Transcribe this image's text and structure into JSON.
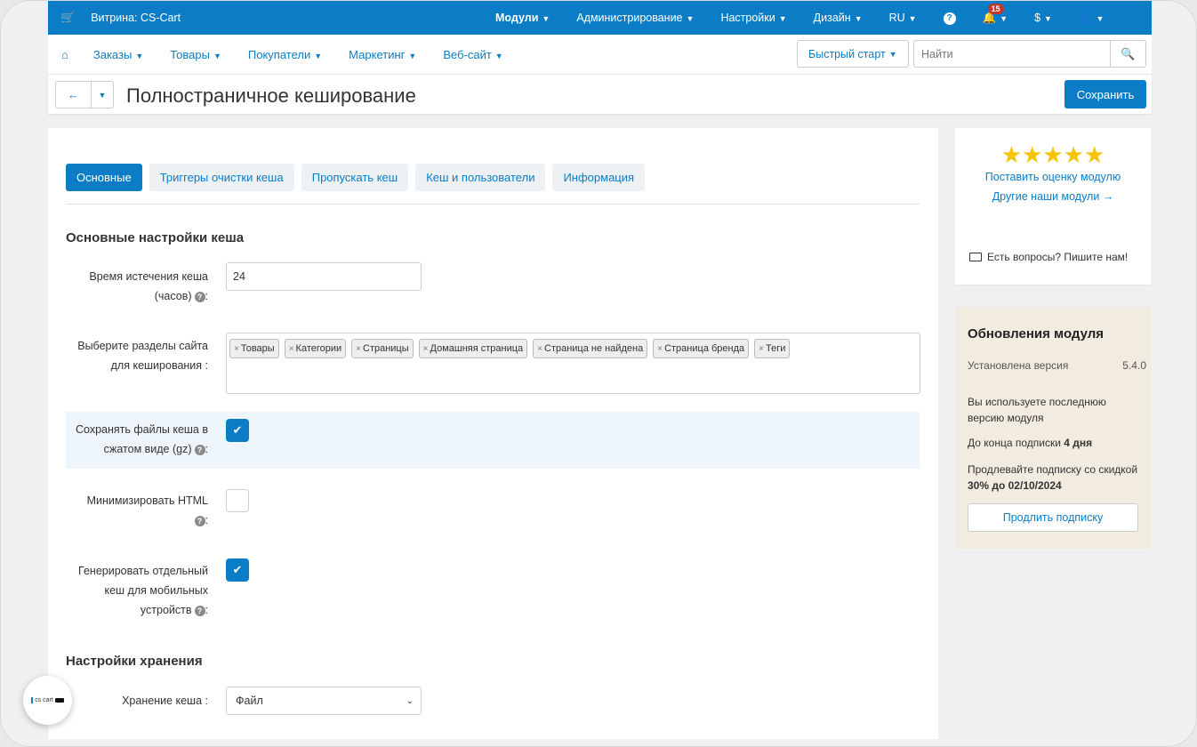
{
  "topbar": {
    "store_label": "Витрина: CS-Cart",
    "menus": [
      "Модули",
      "Администрирование",
      "Настройки",
      "Дизайн",
      "RU"
    ],
    "notifications_count": "15",
    "currency": "$",
    "help_symbol": "?"
  },
  "navbar": {
    "links": [
      "Заказы",
      "Товары",
      "Покупатели",
      "Маркетинг",
      "Веб-сайт"
    ],
    "quick_start": "Быстрый старт",
    "search_placeholder": "Найти"
  },
  "title_bar": {
    "title": "Полностраничное кеширование",
    "save": "Сохранить"
  },
  "tabs": [
    "Основные",
    "Триггеры очистки кеша",
    "Пропускать кеш",
    "Кеш и пользователи",
    "Информация"
  ],
  "form": {
    "section_main": "Основные настройки кеша",
    "expiry_label_1": "Время истечения кеша",
    "expiry_label_2": "(часов)",
    "expiry_value": "24",
    "sections_label_1": "Выберите разделы сайта",
    "sections_label_2": "для кеширования :",
    "section_tags": [
      "Товары",
      "Категории",
      "Страницы",
      "Домашняя страница",
      "Страница не найдена",
      "Страница бренда",
      "Теги"
    ],
    "gzip_label_1": "Сохранять файлы кеша в",
    "gzip_label_2": "сжатом виде (gz)",
    "gzip_checked": true,
    "minify_label_1": "Минимизировать HTML",
    "minify_checked": false,
    "mobile_label_1": "Генерировать отдельный",
    "mobile_label_2": "кеш для мобильных",
    "mobile_label_3": "устройств",
    "mobile_checked": true,
    "section_storage": "Настройки хранения",
    "storage_label": "Хранение кеша :",
    "storage_value": "Файл",
    "colon": ":"
  },
  "sidebar": {
    "rate": "Поставить оценку модулю",
    "other_modules": "Другие наши модули →",
    "contact": "Есть вопросы? Пишите нам!",
    "rating_stars": 5,
    "updates_title": "Обновления модуля",
    "installed_label": "Установлена версия",
    "installed_value": "5.4.0",
    "latest_text": "Вы используете последнюю версию модуля",
    "subscription_prefix": "До конца подписки ",
    "subscription_days": "4 дня",
    "discount_prefix": "Продлевайте подписку со скидкой ",
    "discount_bold": "30% до 02/10/2024",
    "extend_button": "Продлить подписку"
  },
  "logo": {
    "text": "cs cart"
  },
  "colors": {
    "accent": "#0a7dc6",
    "star": "#f4c400",
    "updates_bg": "#f2ebe0"
  }
}
